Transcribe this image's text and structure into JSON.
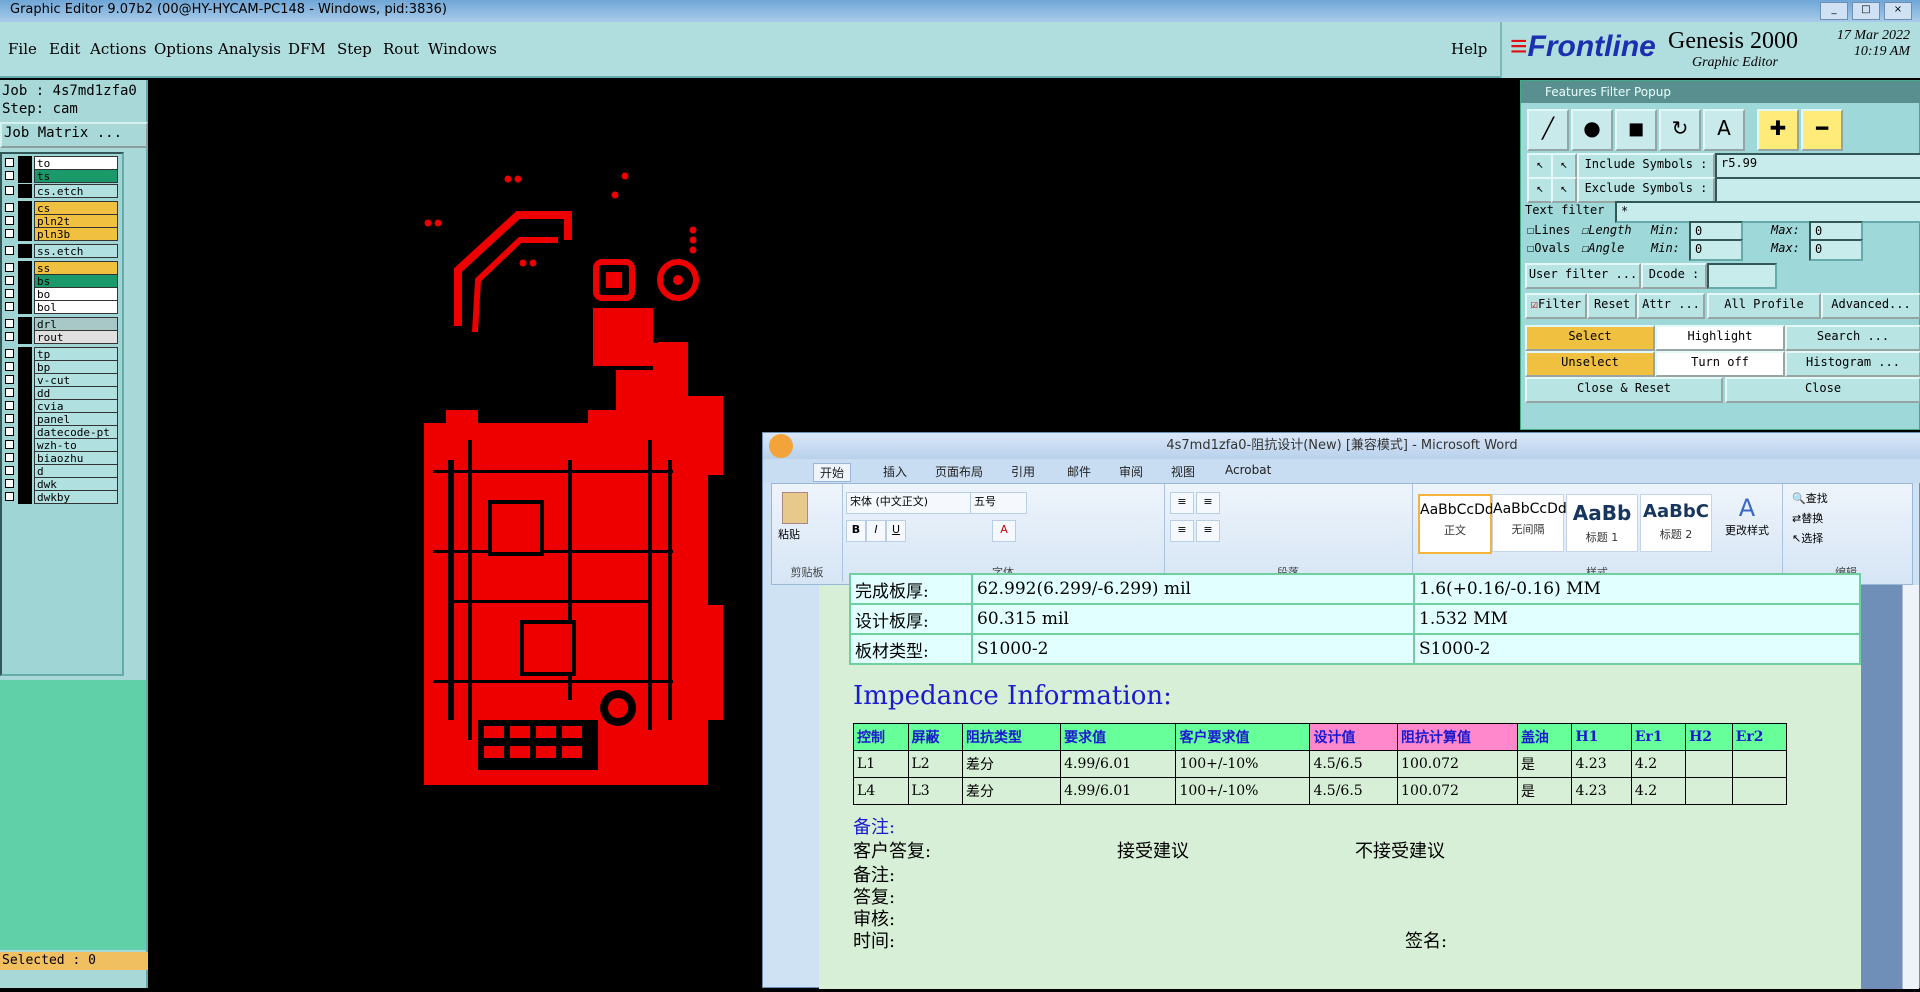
{
  "titlebar": {
    "title": "Graphic Editor 9.07b2 (00@HY-HYCAM-PC148 - Windows, pid:3836)"
  },
  "menu": {
    "items": [
      "File",
      "Edit",
      "Actions",
      "Options",
      "Analysis",
      "DFM",
      "Step",
      "Rout",
      "Windows"
    ],
    "help": "Help"
  },
  "brand": {
    "logo": "Frontline",
    "product": "Genesis 2000",
    "subtitle": "Graphic Editor",
    "date": "17 Mar 2022",
    "time": "10:19 AM"
  },
  "left": {
    "job": "Job : 4s7md1zfa0",
    "step": "Step: cam",
    "job_matrix": "Job Matrix ...",
    "selected": "Selected : 0",
    "layers": [
      {
        "name": "to",
        "bg": "#ffffff"
      },
      {
        "name": "ts",
        "bg": "#1a9a6a"
      },
      {
        "name": "cs.etch",
        "bg": "#b0e0e0"
      },
      {
        "name": "cs",
        "bg": "#f0c040"
      },
      {
        "name": "pln2t",
        "bg": "#f0c040"
      },
      {
        "name": "pln3b",
        "bg": "#f0c040"
      },
      {
        "name": "ss.etch",
        "bg": "#b0e0e0"
      },
      {
        "name": "ss",
        "bg": "#f0c040"
      },
      {
        "name": "bs",
        "bg": "#1a9a6a"
      },
      {
        "name": "bo",
        "bg": "#ffffff"
      },
      {
        "name": "bol",
        "bg": "#ffffff"
      },
      {
        "name": "drl",
        "bg": "#a8c8c8"
      },
      {
        "name": "rout",
        "bg": "#e0e0e0"
      },
      {
        "name": "tp",
        "bg": "#b0e0e0"
      },
      {
        "name": "bp",
        "bg": "#b0e0e0"
      },
      {
        "name": "v-cut",
        "bg": "#b0e0e0"
      },
      {
        "name": "dd",
        "bg": "#b0e0e0"
      },
      {
        "name": "cvia",
        "bg": "#b0e0e0"
      },
      {
        "name": "panel",
        "bg": "#b0e0e0"
      },
      {
        "name": "datecode-pt",
        "bg": "#b0e0e0"
      },
      {
        "name": "wzh-to",
        "bg": "#b0e0e0"
      },
      {
        "name": "biaozhu",
        "bg": "#b0e0e0"
      },
      {
        "name": "d",
        "bg": "#b0e0e0"
      },
      {
        "name": "dwk",
        "bg": "#b0e0e0"
      },
      {
        "name": "dwkby",
        "bg": "#b0e0e0"
      }
    ]
  },
  "ffp": {
    "title": "Features Filter Popup",
    "include_label": "Include Symbols :",
    "include_value": "r5.99",
    "exclude_label": "Exclude Symbols :",
    "text_filter_label": "Text filter",
    "text_filter_value": "*",
    "lines": "Lines",
    "ovals": "Ovals",
    "length": "Length",
    "angle": "Angle",
    "min": "Min:",
    "max": "Max:",
    "min_val": "0",
    "max_val": "0",
    "user_filter": "User filter ...",
    "dcode": "Dcode :",
    "filter": "Filter",
    "reset": "Reset",
    "attr": "Attr ...",
    "all_profile": "All Profile",
    "advanced": "Advanced...",
    "select": "Select",
    "highlight": "Highlight",
    "search": "Search ...",
    "unselect": "Unselect",
    "turn_off": "Turn off",
    "histogram": "Histogram ...",
    "close_reset": "Close & Reset",
    "close": "Close"
  },
  "word": {
    "title": "4s7md1zfa0-阻抗设计(New) [兼容模式] - Microsoft Word",
    "tabs": [
      "开始",
      "插入",
      "页面布局",
      "引用",
      "邮件",
      "审阅",
      "视图",
      "Acrobat"
    ],
    "font_name": "宋体 (中文正文)",
    "font_size": "五号",
    "paste": "粘贴",
    "groups": {
      "clipboard": "剪贴板",
      "font": "字体",
      "paragraph": "段落",
      "styles": "样式",
      "edit": "编辑"
    },
    "styles": [
      {
        "sample": "AaBbCcDd",
        "name": "正文"
      },
      {
        "sample": "AaBbCcDd",
        "name": "无间隔"
      },
      {
        "sample": "AaBb",
        "name": "标题 1"
      },
      {
        "sample": "AaBbC",
        "name": "标题 2"
      }
    ],
    "change_styles": "更改样式",
    "find": "查找",
    "replace": "替换",
    "select": "选择",
    "thick_table": [
      [
        "完成板厚:",
        "62.992(6.299/-6.299) mil",
        "1.6(+0.16/-0.16) MM"
      ],
      [
        "设计板厚:",
        "60.315 mil",
        "1.532 MM"
      ],
      [
        "板材类型:",
        "S1000-2",
        "S1000-2"
      ]
    ],
    "impedance_heading": "Impedance Information:",
    "imp_headers": [
      "控制",
      "屏蔽",
      "阻抗类型",
      "要求值",
      "客户要求值",
      "设计值",
      "阻抗计算值",
      "盖油",
      "H1",
      "Er1",
      "H2",
      "Er2"
    ],
    "imp_rows": [
      [
        "L1",
        "L2",
        "差分",
        "4.99/6.01",
        "100+/-10%",
        "4.5/6.5",
        "100.072",
        "是",
        "4.23",
        "4.2",
        "",
        ""
      ],
      [
        "L4",
        "L3",
        "差分",
        "4.99/6.01",
        "100+/-10%",
        "4.5/6.5",
        "100.072",
        "是",
        "4.23",
        "4.2",
        "",
        ""
      ]
    ],
    "note_blue": "备注:",
    "customer_reply": "客户答复:",
    "accept": "接受建议",
    "reject": "不接受建议",
    "note": "备注:",
    "answer": "答复:",
    "review": "审核:",
    "time": "时间:",
    "sign": "签名:"
  }
}
